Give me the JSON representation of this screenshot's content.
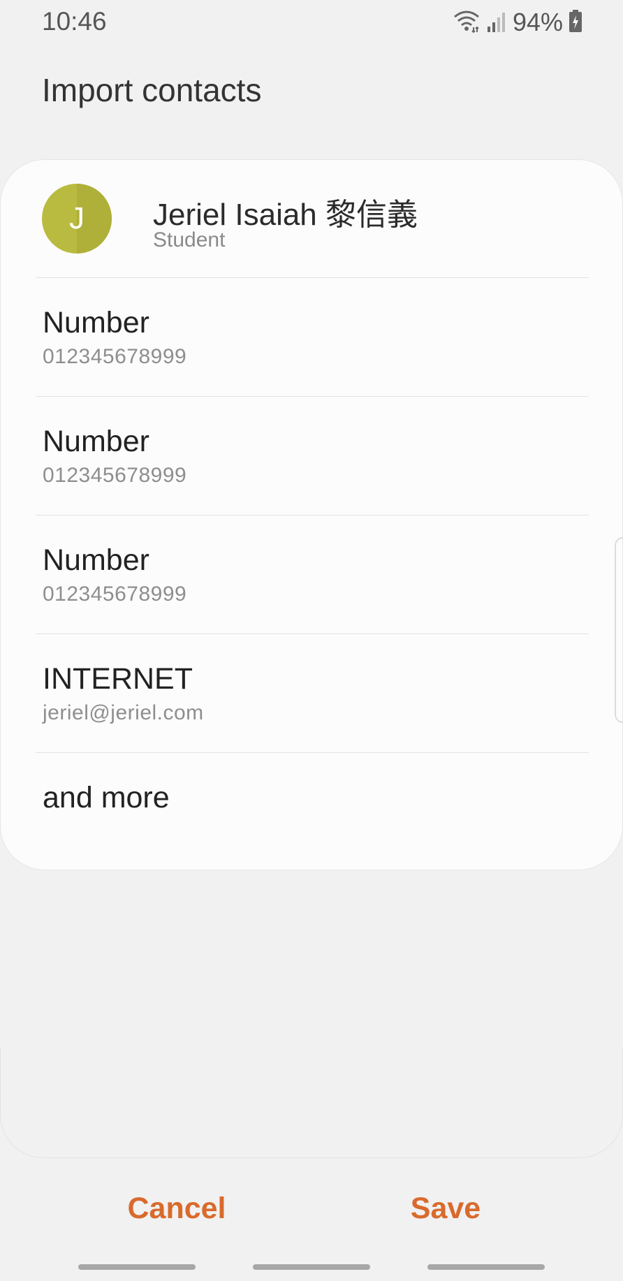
{
  "status_bar": {
    "time": "10:46",
    "battery_percent": "94%",
    "wifi_icon": "wifi-icon",
    "signal_icon": "signal-icon",
    "battery_icon": "battery-charging-icon"
  },
  "page": {
    "title": "Import contacts"
  },
  "contact": {
    "initial": "J",
    "name": "Jeriel Isaiah 黎信義",
    "subtitle": "Student",
    "avatar_color": "#b9bb40"
  },
  "fields": [
    {
      "label": "Number",
      "value": "012345678999"
    },
    {
      "label": "Number",
      "value": "012345678999"
    },
    {
      "label": "Number",
      "value": "012345678999"
    },
    {
      "label": "INTERNET",
      "value": "jeriel@jeriel.com"
    }
  ],
  "more": {
    "label": "and more"
  },
  "actions": {
    "cancel_label": "Cancel",
    "save_label": "Save",
    "accent_color": "#d96a2c"
  }
}
